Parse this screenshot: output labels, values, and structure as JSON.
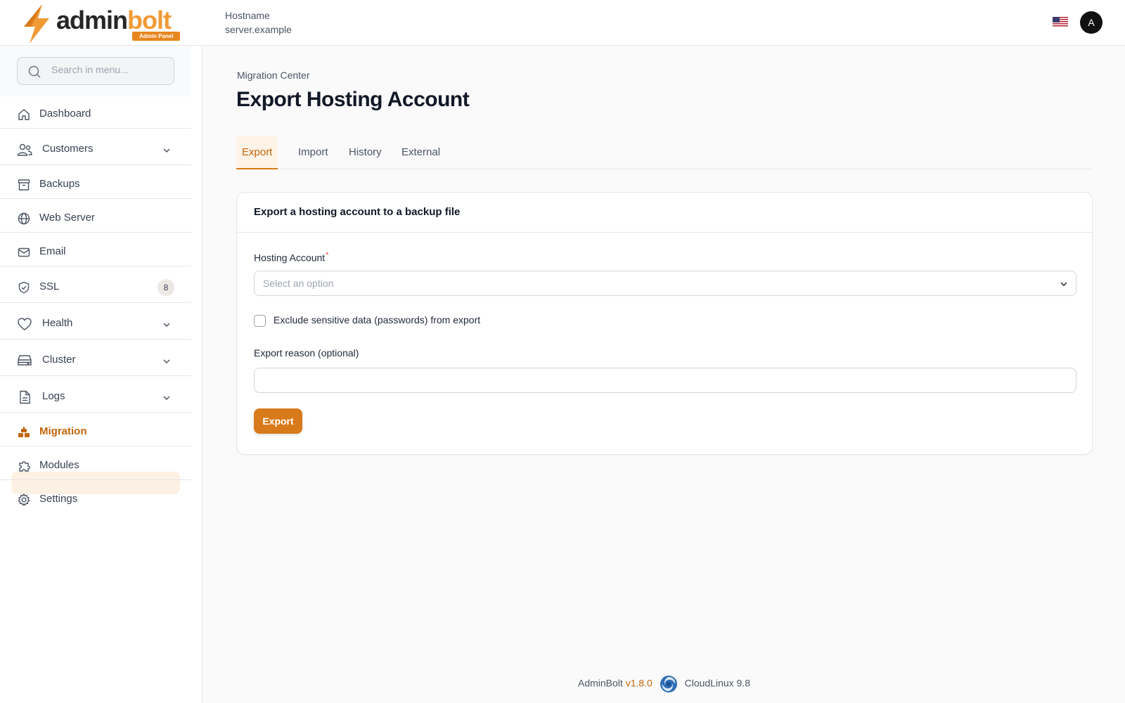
{
  "brand": {
    "name_part1": "admin",
    "name_part2": "bolt",
    "tag": "Admin Panel"
  },
  "header": {
    "hostname_label": "Hostname",
    "hostname_value": "server.example",
    "avatar_letter": "A"
  },
  "sidebar": {
    "search_placeholder": "Search in menu...",
    "items": [
      {
        "label": "Dashboard",
        "icon": "home-icon"
      },
      {
        "label": "Customers",
        "icon": "users-icon",
        "expandable": true
      },
      {
        "label": "Backups",
        "icon": "archive-icon"
      },
      {
        "label": "Web Server",
        "icon": "globe-icon"
      },
      {
        "label": "Email",
        "icon": "mail-icon"
      },
      {
        "label": "SSL",
        "icon": "shield-icon",
        "badge": "8"
      },
      {
        "label": "Health",
        "icon": "heart-icon",
        "expandable": true
      },
      {
        "label": "Cluster",
        "icon": "server-icon",
        "expandable": true
      },
      {
        "label": "Logs",
        "icon": "file-icon",
        "expandable": true
      },
      {
        "label": "Migration",
        "icon": "migration-icon",
        "active": true
      },
      {
        "label": "Modules",
        "icon": "puzzle-icon"
      },
      {
        "label": "Settings",
        "icon": "gear-icon"
      }
    ]
  },
  "main": {
    "breadcrumb": "Migration Center",
    "title": "Export Hosting Account",
    "tabs": [
      "Export",
      "Import",
      "History",
      "External"
    ],
    "active_tab": "Export",
    "card": {
      "title": "Export a hosting account to a backup file",
      "hosting_account_label": "Hosting Account",
      "required_mark": "*",
      "select_placeholder": "Select an option",
      "checkbox_label": "Exclude sensitive data (passwords) from export",
      "checkbox_checked": false,
      "reason_label": "Export reason (optional)",
      "reason_value": "",
      "export_button": "Export"
    }
  },
  "footer": {
    "product": "AdminBolt",
    "version": "v1.8.0",
    "os": "CloudLinux 9.8"
  },
  "colors": {
    "accent": "#d97a1a",
    "accent_light": "#fdf1e3",
    "brand_orange": "#f09a36"
  }
}
